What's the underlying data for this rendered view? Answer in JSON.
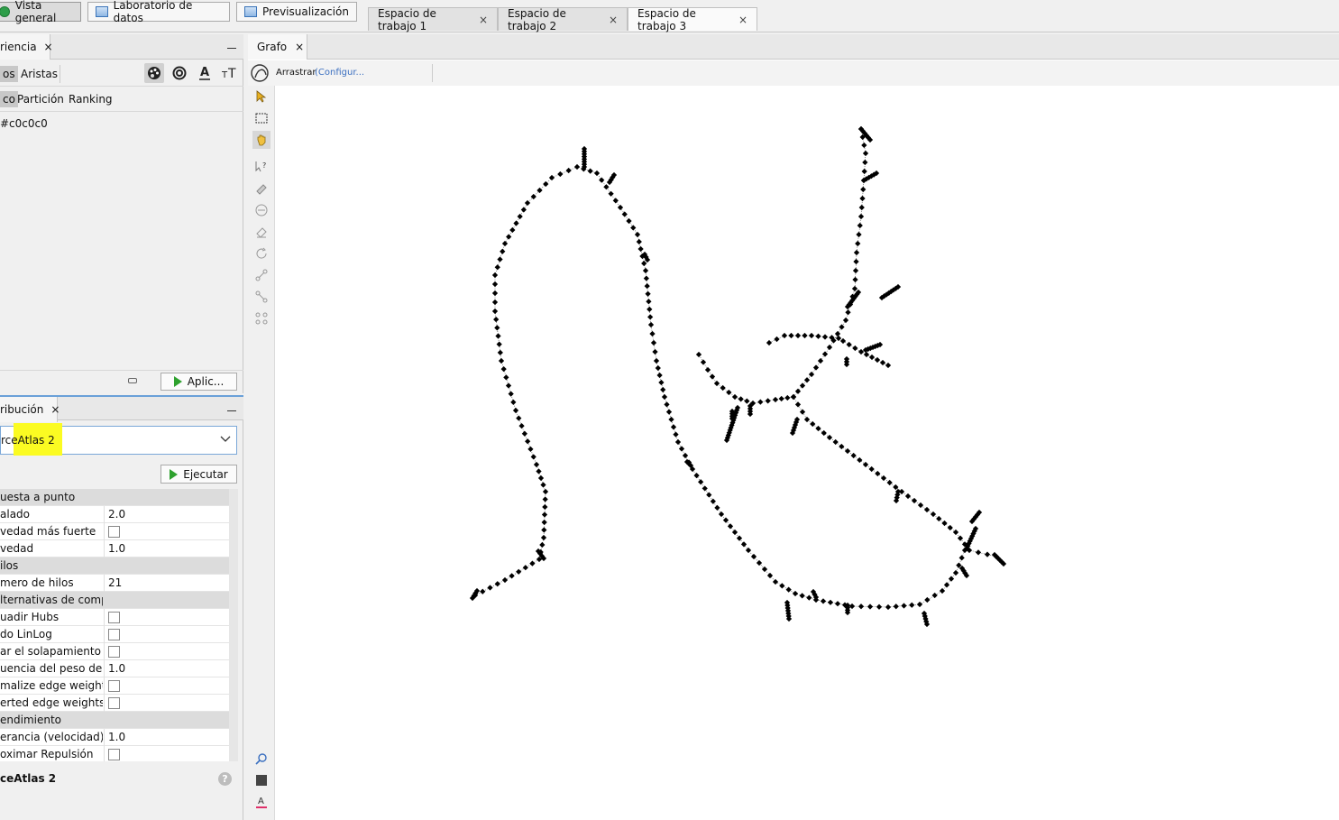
{
  "topbar": {
    "modes": [
      {
        "label": "Vista general",
        "active": true
      },
      {
        "label": "Laboratorio de datos",
        "active": false
      },
      {
        "label": "Previsualización",
        "active": false
      }
    ],
    "workspaces": [
      {
        "label": "Espacio de trabajo 1",
        "active": false
      },
      {
        "label": "Espacio de trabajo 2",
        "active": false
      },
      {
        "label": "Espacio de trabajo 3",
        "active": true
      }
    ],
    "close_glyph": "×"
  },
  "appearance": {
    "tab_label": "riencia",
    "target_tabs": {
      "nodes": "os",
      "edges": "Aristas"
    },
    "color_tabs": {
      "unique": "co",
      "partition": "Partición",
      "ranking": "Ranking"
    },
    "color_value": "#c0c0c0",
    "apply_label": "Aplic..."
  },
  "layout": {
    "tab_label": "ribución",
    "selected_prefix": "rce",
    "selected_highlight": "Atlas 2",
    "run_label": "Ejecutar",
    "properties": [
      {
        "type": "category",
        "label": "uesta a punto"
      },
      {
        "type": "value",
        "label": "alado",
        "value": "2.0"
      },
      {
        "type": "checkbox",
        "label": "vedad más fuerte",
        "checked": false
      },
      {
        "type": "value",
        "label": "vedad",
        "value": "1.0"
      },
      {
        "type": "category",
        "label": "ilos"
      },
      {
        "type": "value",
        "label": "mero de hilos",
        "value": "21"
      },
      {
        "type": "category",
        "label": "lternativas de comportamiento"
      },
      {
        "type": "checkbox",
        "label": "uadir Hubs",
        "checked": false
      },
      {
        "type": "checkbox",
        "label": "do LinLog",
        "checked": false
      },
      {
        "type": "checkbox",
        "label": "ar el solapamiento",
        "checked": false
      },
      {
        "type": "value",
        "label": "uencia del peso de las",
        "value": "1.0"
      },
      {
        "type": "checkbox",
        "label": "malize edge weights",
        "checked": false
      },
      {
        "type": "checkbox",
        "label": "erted edge weights",
        "checked": false
      },
      {
        "type": "category",
        "label": "endimiento"
      },
      {
        "type": "value",
        "label": "erancia (velocidad)",
        "value": "1.0"
      },
      {
        "type": "checkbox",
        "label": "oximar Repulsión",
        "checked": false
      }
    ],
    "footer_name": "ceAtlas 2",
    "help_glyph": "?"
  },
  "graph": {
    "tab_label": "Grafo",
    "tool_label": "Arrastrar",
    "config_label": "(Configur...",
    "node_color": "#000000",
    "edge_color": "#444444"
  }
}
